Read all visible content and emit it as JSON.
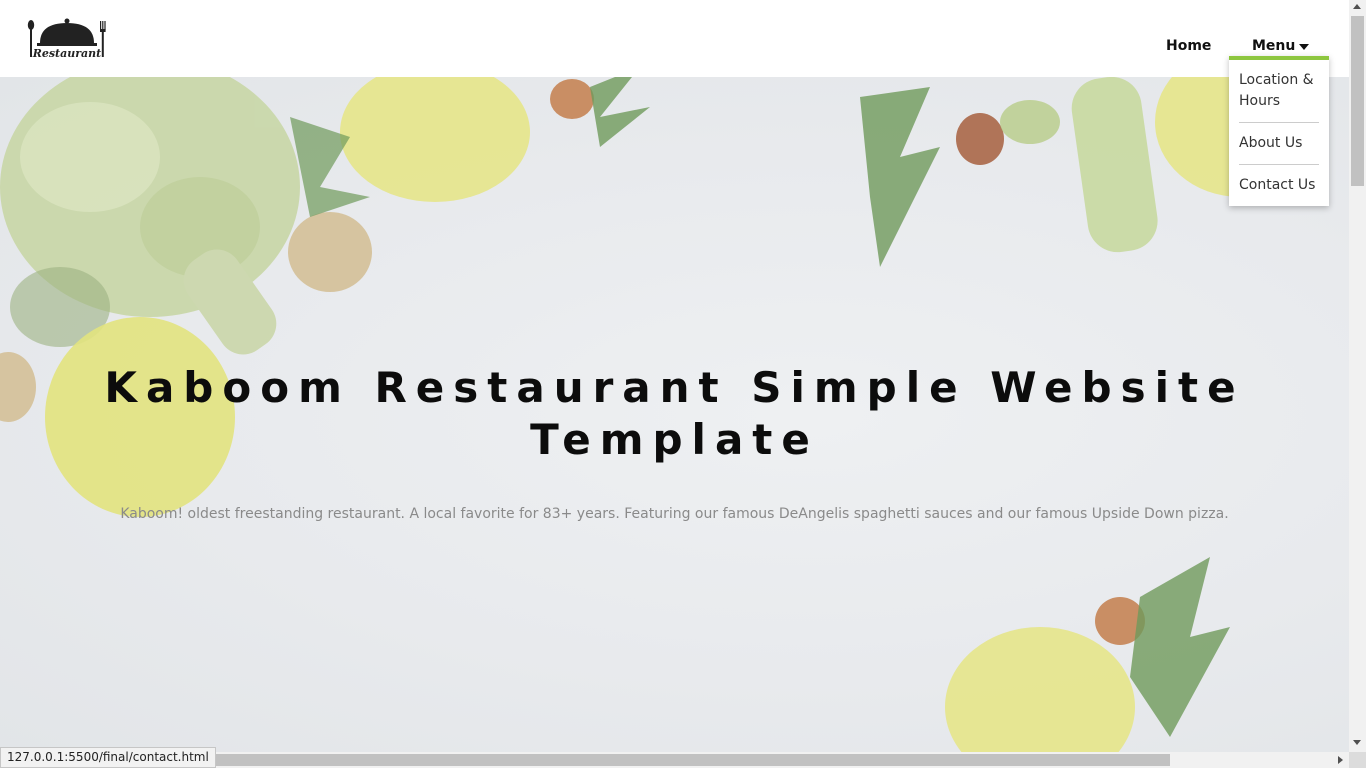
{
  "header": {
    "logo_text": "Restaurant",
    "nav": {
      "home": "Home",
      "menu": "Menu"
    }
  },
  "dropdown": {
    "items": [
      "Location & Hours",
      "About Us",
      "Contact Us"
    ],
    "accent_color": "#8dc63f"
  },
  "hero": {
    "title": "Kaboom Restaurant Simple Website Template",
    "subtitle": "Kaboom! oldest freestanding restaurant. A local favorite for 83+ years. Featuring our famous DeAngelis spaghetti sauces and our famous Upside Down pizza."
  },
  "status_bar": {
    "url": "127.0.0.1:5500/final/contact.html"
  }
}
